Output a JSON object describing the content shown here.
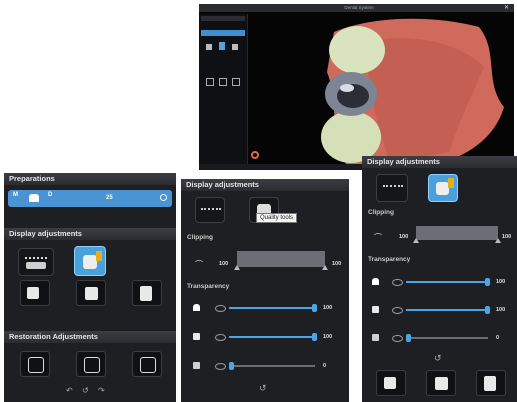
{
  "viewer": {
    "title": "Dental System",
    "left_panel_label": "Preparations",
    "icon_names": [
      "gear-icon",
      "close-icon",
      "crown-icon",
      "implant-icon",
      "tooth-icon"
    ]
  },
  "preparations_panel": {
    "title": "Preparations",
    "row": {
      "left": "M",
      "right": "D",
      "number": "25"
    },
    "display_title": "Display adjustments",
    "restoration_title": "Restoration Adjustments"
  },
  "middle_panel": {
    "title": "Display adjustments",
    "tooltip": "Quality tools",
    "clipping_label": "Clipping",
    "clip_min": "100",
    "clip_max": "100",
    "transparency_label": "Transparency",
    "rows": [
      {
        "value": "100",
        "level": 1.0
      },
      {
        "value": "100",
        "level": 1.0
      },
      {
        "value": "0",
        "level": 0.0
      }
    ]
  },
  "right_panel": {
    "title": "Display adjustments",
    "clipping_label": "Clipping",
    "clip_min": "100",
    "clip_max": "100",
    "transparency_label": "Transparency",
    "rows": [
      {
        "value": "100",
        "level": 1.0
      },
      {
        "value": "100",
        "level": 1.0
      },
      {
        "value": "0",
        "level": 0.0
      }
    ]
  },
  "colors": {
    "accent": "#4aa6e6",
    "panel": "#1e1f22",
    "selected_tile": "#4aa0d8",
    "gum": "#d3695e",
    "tooth": "#d9e3be"
  }
}
